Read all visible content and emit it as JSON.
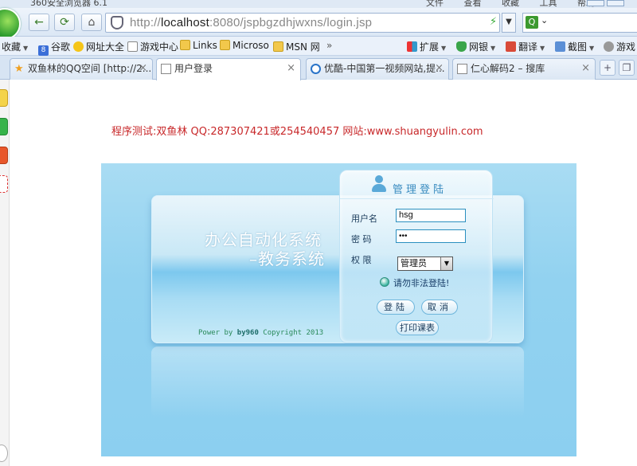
{
  "browser": {
    "app_title": "360安全浏览器 6.1",
    "menu": [
      "文件",
      "查看",
      "收藏",
      "工具",
      "帮助"
    ],
    "url_host": "localhost",
    "url_rest": ":8080/jspbgzdhjwxns/login.jsp",
    "url_prefix": "http://",
    "search_caret": "⌄"
  },
  "bookmarks": {
    "favorites_label": "收藏",
    "items": [
      "谷歌",
      "网址大全",
      "游戏中心",
      "Links",
      "Microso",
      "MSN 网"
    ],
    "more": "»",
    "right_items": [
      "扩展",
      "网银",
      "翻译",
      "截图",
      "游戏"
    ]
  },
  "tabs": [
    {
      "title": "双鱼林的QQ空间 [http://2..."
    },
    {
      "title": "用户登录"
    },
    {
      "title": "优酷-中国第一视频网站,提..."
    },
    {
      "title": "仁心解码2 – 搜库"
    }
  ],
  "page": {
    "notice": "程序测试:双鱼林 QQ:287307421或254540457 网站:www.shuangyulin.com",
    "system_title": "办公自动化系统",
    "system_subtitle": "–教务系统",
    "copyright_prefix": "Power by",
    "copyright_brand": "by960",
    "copyright_suffix": "Copyright 2013",
    "login": {
      "title": "管理登陆",
      "username_label": "用户名",
      "username_value": "hsg",
      "password_label": "密 码",
      "password_value": "•••",
      "role_label": "权 限",
      "role_value": "管理员",
      "warning": "请勿非法登陆!",
      "login_button": "登陆",
      "cancel_button": "取消",
      "print_button": "打印课表"
    }
  }
}
